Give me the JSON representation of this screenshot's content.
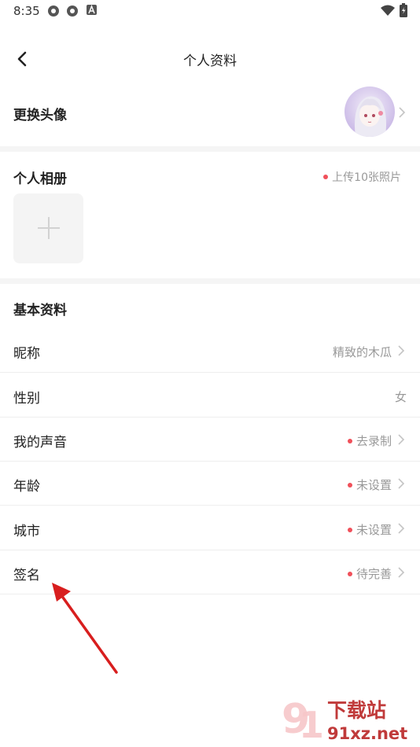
{
  "status_bar": {
    "time": "8:35",
    "icons": [
      "app-icon",
      "app-icon",
      "a-icon",
      "wifi-icon",
      "battery-icon"
    ]
  },
  "nav": {
    "title": "个人资料",
    "back_icon": "chevron-left-icon"
  },
  "avatar_row": {
    "label": "更换头像"
  },
  "album": {
    "title": "个人相册",
    "hint": "上传10张照片",
    "add_icon": "plus-icon"
  },
  "basic": {
    "title": "基本资料",
    "rows": [
      {
        "label": "昵称",
        "value": "精致的木瓜"
      },
      {
        "label": "性别",
        "value": "女"
      },
      {
        "label": "我的声音",
        "value": "去录制"
      },
      {
        "label": "年龄",
        "value": "未设置"
      },
      {
        "label": "城市",
        "value": "未设置"
      },
      {
        "label": "签名",
        "value": "待完善"
      }
    ]
  },
  "watermark": {
    "brand": "下载站",
    "site": "91xz.net"
  },
  "colors": {
    "red_dot": "#f0505a",
    "arrow": "#d81e1e",
    "muted_text": "#999999",
    "separator": "#f5f5f5"
  }
}
